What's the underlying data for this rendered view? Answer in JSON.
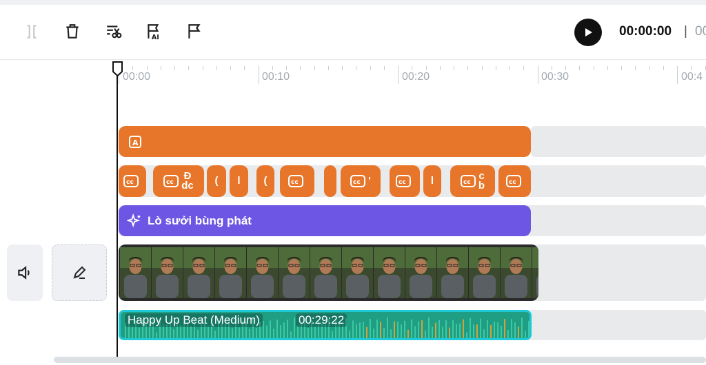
{
  "toolbar": {
    "tools": [
      {
        "name": "split-icon",
        "enabled": false
      },
      {
        "name": "delete-icon",
        "enabled": true
      },
      {
        "name": "scissors-icon",
        "enabled": true
      },
      {
        "name": "ai-flag-icon",
        "enabled": true
      },
      {
        "name": "flag-icon",
        "enabled": true
      }
    ],
    "time_current": "00:00:00",
    "time_separator": "|",
    "time_total": "00"
  },
  "ruler": {
    "labels": [
      "00:00",
      "00:10",
      "00:20",
      "00:30",
      "00:4"
    ]
  },
  "tracks": {
    "text_track": {
      "icon": "text-a-icon",
      "color": "#e8762a"
    },
    "caption_track": {
      "color": "#e8762a",
      "clips": [
        {
          "label": ""
        },
        {
          "label": "Đ dc"
        },
        {
          "label": "("
        },
        {
          "label": "l"
        },
        {
          "label": "("
        },
        {
          "label": ""
        },
        {
          "label": ""
        },
        {
          "label": "'"
        },
        {
          "label": ""
        },
        {
          "label": "l"
        },
        {
          "label": "c b"
        },
        {
          "label": ""
        }
      ]
    },
    "effect_track": {
      "icon": "sparkle-icon",
      "label": "Lò sưởi bùng phát",
      "color": "#6e56e4"
    },
    "video_track": {
      "frame_count": 14
    },
    "audio_track": {
      "title": "Happy Up Beat (Medium)",
      "duration": "00:29:22",
      "color": "#1f9e84",
      "border_color": "#1ec8d4"
    }
  },
  "side_controls": {
    "volume_icon": "speaker-icon",
    "edit_icon": "pencil-icon"
  },
  "colors": {
    "accent_orange": "#e8762a",
    "accent_purple": "#6e56e4",
    "audio_green": "#1f9e84"
  }
}
